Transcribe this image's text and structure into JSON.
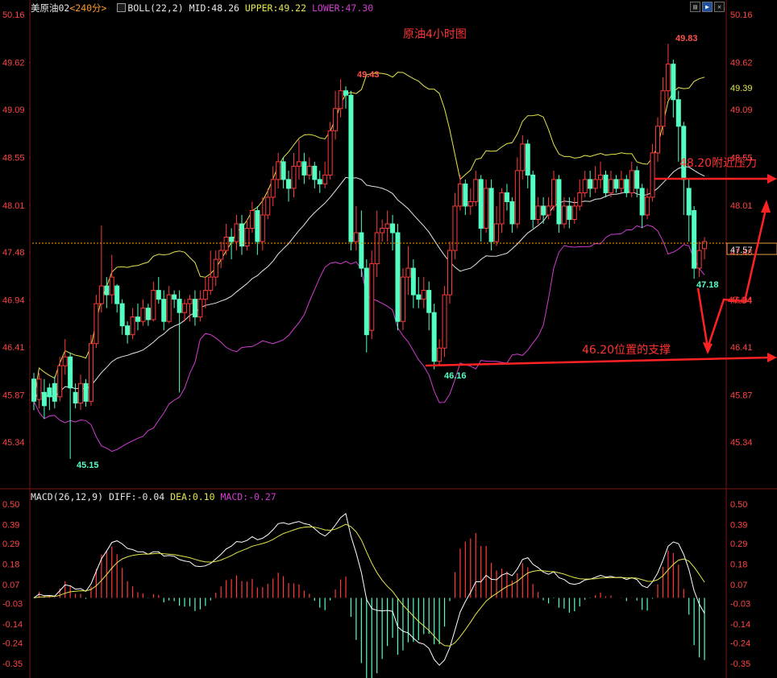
{
  "window": {
    "symbol": "美原油02",
    "period": "<240分>",
    "toolbar_icons": [
      "panel-icon",
      "chart-icon",
      "expand-icon",
      "close-icon"
    ]
  },
  "boll_legend": {
    "name": "BOLL(22,2)",
    "mid": "MID:48.26",
    "upper": "UPPER:49.22",
    "lower": "LOWER:47.30"
  },
  "macd_legend": {
    "name": "MACD(26,12,9)",
    "diff": "DIFF:-0.04",
    "dea": "DEA:0.10",
    "macd": "MACD:-0.27"
  },
  "price_chart": {
    "title": "原油4小时图",
    "y_ticks": [
      "50.16",
      "49.62",
      "49.09",
      "48.55",
      "48.01",
      "47.48",
      "46.94",
      "46.41",
      "45.87",
      "45.34"
    ],
    "last_price_label": "47.57",
    "upper_band_label": "49.39",
    "annotations": {
      "high_1": "49.43",
      "high_2": "49.83",
      "low_1": "45.15",
      "low_2": "46.16",
      "low_3": "47.18",
      "resistance_text": "48.20附近压力",
      "support_text": "46.20位置的支撑",
      "target_text": "47.04"
    }
  },
  "macd_chart": {
    "y_ticks": [
      "0.50",
      "0.39",
      "0.29",
      "0.18",
      "0.07",
      "-0.03",
      "-0.14",
      "-0.24",
      "-0.35"
    ]
  },
  "colors": {
    "up": "#ff3a3a",
    "down": "#54ffc2",
    "upper": "#e6e64c",
    "mid": "#e6e6e6",
    "lower": "#d23cd2",
    "annotation": "#ff3333",
    "axis_text": "#ff4444",
    "grid": "#7a1414"
  },
  "chart_data": [
    {
      "type": "candlestick",
      "title": "原油4小时图",
      "ylim": [
        45.0,
        50.3
      ],
      "candles": [
        [
          46.05,
          45.8,
          46.12,
          45.7
        ],
        [
          45.82,
          46.05,
          46.12,
          45.72
        ],
        [
          45.9,
          45.75,
          46.05,
          45.6
        ],
        [
          45.95,
          45.85,
          46.0,
          45.7
        ],
        [
          46.0,
          45.8,
          46.08,
          45.72
        ],
        [
          45.85,
          46.2,
          46.3,
          45.8
        ],
        [
          46.2,
          46.3,
          46.5,
          46.1
        ],
        [
          46.3,
          45.95,
          46.35,
          45.15
        ],
        [
          45.9,
          45.78,
          46.0,
          45.72
        ],
        [
          45.78,
          46.0,
          46.1,
          45.7
        ],
        [
          46.0,
          45.8,
          46.05,
          45.74
        ],
        [
          45.8,
          46.45,
          46.55,
          45.75
        ],
        [
          46.45,
          46.9,
          47.0,
          46.4
        ],
        [
          46.9,
          47.1,
          47.78,
          46.8
        ],
        [
          47.1,
          47.0,
          47.2,
          46.85
        ],
        [
          47.0,
          47.2,
          47.45,
          46.9
        ],
        [
          47.1,
          46.9,
          47.12,
          46.8
        ],
        [
          46.9,
          46.65,
          46.95,
          46.55
        ],
        [
          46.65,
          46.55,
          46.7,
          46.45
        ],
        [
          46.55,
          46.75,
          46.85,
          46.5
        ],
        [
          46.75,
          46.7,
          46.9,
          46.6
        ],
        [
          46.7,
          46.85,
          46.95,
          46.65
        ],
        [
          46.85,
          46.72,
          46.9,
          46.65
        ],
        [
          46.72,
          47.05,
          47.15,
          46.7
        ],
        [
          47.05,
          46.95,
          47.2,
          46.9
        ],
        [
          46.95,
          46.7,
          47.05,
          46.6
        ],
        [
          46.7,
          47.0,
          47.1,
          46.68
        ],
        [
          47.0,
          46.95,
          47.05,
          46.85
        ],
        [
          46.95,
          46.8,
          47.05,
          45.9
        ],
        [
          46.8,
          46.9,
          46.95,
          46.7
        ],
        [
          46.9,
          46.95,
          47.0,
          46.7
        ],
        [
          46.95,
          46.75,
          47.05,
          46.65
        ],
        [
          46.75,
          46.95,
          47.05,
          46.7
        ],
        [
          46.95,
          47.05,
          47.2,
          46.85
        ],
        [
          47.05,
          47.2,
          47.5,
          47.0
        ],
        [
          47.2,
          47.4,
          47.5,
          47.1
        ],
        [
          47.4,
          47.5,
          47.6,
          47.3
        ],
        [
          47.5,
          47.65,
          47.8,
          47.45
        ],
        [
          47.65,
          47.6,
          47.75,
          47.4
        ],
        [
          47.6,
          47.8,
          47.9,
          47.5
        ],
        [
          47.8,
          47.55,
          47.9,
          47.45
        ],
        [
          47.55,
          47.75,
          47.85,
          47.5
        ],
        [
          47.75,
          47.95,
          48.05,
          47.7
        ],
        [
          47.95,
          47.6,
          48.0,
          47.45
        ],
        [
          47.6,
          47.9,
          48.1,
          47.5
        ],
        [
          47.9,
          48.1,
          48.2,
          47.85
        ],
        [
          48.1,
          48.3,
          48.45,
          48.0
        ],
        [
          48.3,
          48.5,
          48.6,
          48.2
        ],
        [
          48.5,
          48.3,
          48.55,
          48.2
        ],
        [
          48.3,
          48.2,
          48.4,
          48.05
        ],
        [
          48.2,
          48.45,
          48.6,
          48.1
        ],
        [
          48.45,
          48.5,
          48.75,
          48.3
        ],
        [
          48.5,
          48.35,
          48.6,
          48.25
        ],
        [
          48.35,
          48.45,
          48.55,
          48.3
        ],
        [
          48.45,
          48.3,
          48.5,
          48.2
        ],
        [
          48.3,
          48.25,
          48.4,
          48.15
        ],
        [
          48.25,
          48.35,
          48.5,
          48.2
        ],
        [
          48.35,
          48.85,
          48.95,
          48.3
        ],
        [
          48.85,
          49.1,
          49.3,
          48.75
        ],
        [
          49.1,
          49.3,
          49.43,
          49.0
        ],
        [
          49.3,
          49.25,
          49.35,
          49.1
        ],
        [
          49.25,
          47.6,
          49.3,
          47.5
        ],
        [
          47.6,
          47.7,
          48.0,
          47.5
        ],
        [
          47.7,
          47.3,
          47.95,
          47.2
        ],
        [
          47.3,
          46.55,
          47.4,
          46.35
        ],
        [
          46.6,
          47.35,
          47.5,
          46.5
        ],
        [
          47.35,
          47.7,
          47.95,
          47.2
        ],
        [
          47.7,
          47.75,
          47.85,
          47.6
        ],
        [
          47.75,
          47.8,
          47.95,
          47.6
        ],
        [
          47.8,
          47.7,
          47.9,
          47.5
        ],
        [
          47.7,
          46.7,
          47.8,
          46.6
        ],
        [
          46.7,
          47.2,
          47.3,
          46.6
        ],
        [
          47.2,
          47.3,
          47.55,
          47.0
        ],
        [
          47.3,
          47.0,
          47.4,
          46.85
        ],
        [
          47.0,
          46.95,
          47.2,
          46.85
        ],
        [
          46.95,
          47.05,
          47.2,
          46.85
        ],
        [
          47.05,
          46.8,
          47.15,
          46.6
        ],
        [
          46.8,
          46.25,
          46.9,
          46.16
        ],
        [
          46.25,
          46.4,
          46.5,
          46.2
        ],
        [
          46.4,
          47.0,
          47.1,
          46.3
        ],
        [
          47.0,
          47.5,
          47.6,
          46.9
        ],
        [
          47.5,
          48.0,
          48.15,
          47.4
        ],
        [
          48.0,
          48.25,
          48.35,
          47.95
        ],
        [
          48.25,
          48.0,
          48.3,
          47.9
        ],
        [
          48.0,
          48.05,
          48.2,
          47.9
        ],
        [
          48.05,
          48.3,
          48.4,
          48.0
        ],
        [
          48.3,
          47.75,
          48.35,
          47.6
        ],
        [
          47.75,
          48.2,
          48.3,
          47.7
        ],
        [
          48.2,
          47.6,
          48.3,
          47.5
        ],
        [
          47.6,
          47.8,
          48.0,
          47.55
        ],
        [
          47.8,
          48.15,
          48.2,
          47.7
        ],
        [
          48.15,
          48.05,
          48.25,
          47.95
        ],
        [
          48.05,
          47.8,
          48.1,
          47.7
        ],
        [
          47.8,
          48.4,
          48.55,
          47.75
        ],
        [
          48.4,
          48.7,
          48.8,
          48.3
        ],
        [
          48.7,
          48.35,
          48.75,
          48.2
        ],
        [
          48.35,
          47.85,
          48.4,
          47.75
        ],
        [
          47.85,
          48.0,
          48.1,
          47.8
        ],
        [
          48.0,
          47.9,
          48.1,
          47.8
        ],
        [
          47.9,
          48.0,
          48.1,
          47.85
        ],
        [
          48.0,
          48.3,
          48.4,
          47.95
        ],
        [
          48.3,
          47.8,
          48.35,
          47.7
        ],
        [
          47.8,
          48.0,
          48.1,
          47.75
        ],
        [
          48.0,
          47.85,
          48.1,
          47.75
        ],
        [
          47.85,
          48.0,
          48.1,
          47.8
        ],
        [
          48.0,
          48.15,
          48.3,
          47.95
        ],
        [
          48.15,
          48.3,
          48.4,
          48.1
        ],
        [
          48.3,
          48.2,
          48.4,
          48.1
        ],
        [
          48.2,
          48.3,
          48.45,
          48.15
        ],
        [
          48.3,
          48.35,
          48.5,
          48.2
        ],
        [
          48.35,
          48.15,
          48.4,
          48.1
        ],
        [
          48.15,
          48.3,
          48.4,
          48.1
        ],
        [
          48.3,
          48.2,
          48.35,
          48.15
        ],
        [
          48.2,
          48.3,
          48.4,
          48.15
        ],
        [
          48.3,
          48.15,
          48.35,
          48.1
        ],
        [
          48.15,
          48.4,
          48.5,
          48.1
        ],
        [
          48.4,
          48.2,
          48.45,
          48.1
        ],
        [
          48.2,
          47.9,
          48.25,
          47.75
        ],
        [
          47.9,
          48.1,
          48.2,
          47.85
        ],
        [
          48.1,
          48.6,
          48.7,
          48.05
        ],
        [
          48.6,
          48.9,
          49.0,
          48.5
        ],
        [
          48.9,
          49.3,
          49.45,
          48.8
        ],
        [
          49.3,
          49.6,
          49.83,
          49.2
        ],
        [
          49.6,
          49.2,
          49.65,
          49.0
        ],
        [
          49.2,
          48.9,
          49.3,
          48.5
        ],
        [
          48.9,
          48.3,
          48.95,
          47.9
        ],
        [
          48.2,
          47.9,
          48.3,
          47.6
        ],
        [
          47.95,
          47.3,
          48.0,
          47.18
        ],
        [
          47.3,
          47.5,
          47.6,
          47.2
        ],
        [
          47.52,
          47.6,
          47.65,
          47.4
        ]
      ],
      "boll": {
        "upper": 49.22,
        "mid": 48.26,
        "lower": 47.3
      },
      "annotations": {
        "resistance": 48.2,
        "support": 46.2
      }
    },
    {
      "type": "bar",
      "title": "MACD(26,12,9)",
      "ylim": [
        -0.38,
        0.52
      ],
      "diff": -0.04,
      "dea": 0.1,
      "macd": -0.27
    }
  ]
}
